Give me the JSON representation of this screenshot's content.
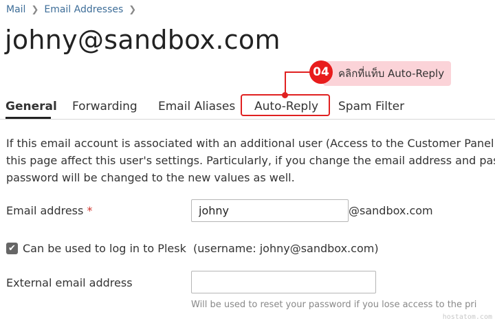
{
  "breadcrumb": {
    "items": [
      "Mail",
      "Email Addresses"
    ],
    "separator": ">"
  },
  "page": {
    "title": "johny@sandbox.com"
  },
  "tabs": [
    {
      "label": "General",
      "active": true
    },
    {
      "label": "Forwarding",
      "active": false
    },
    {
      "label": "Email Aliases",
      "active": false
    },
    {
      "label": "Auto-Reply",
      "active": false,
      "highlighted": true
    },
    {
      "label": "Spam Filter",
      "active": false
    }
  ],
  "callout": {
    "step": "04",
    "text": "คลิกที่แท็บ Auto-Reply",
    "color": "#e81c1c"
  },
  "description": {
    "line1": "If this email account is associated with an additional user (Access to the Customer Panel",
    "line2": "this page affect this user's settings. Particularly, if you change the email address and pas",
    "line3": "password will be changed to the new values as well."
  },
  "form": {
    "email_label": "Email address",
    "required_mark": "*",
    "email_value": "johny",
    "email_domain": "@sandbox.com",
    "plesk_login_label": "Can be used to log in to Plesk",
    "plesk_login_checked": true,
    "plesk_username_note": "(username: johny@sandbox.com)",
    "external_email_label": "External email address",
    "external_email_value": "",
    "external_email_hint": "Will be used to reset your password if you lose access to the pri"
  },
  "watermark": "hostatom.com"
}
